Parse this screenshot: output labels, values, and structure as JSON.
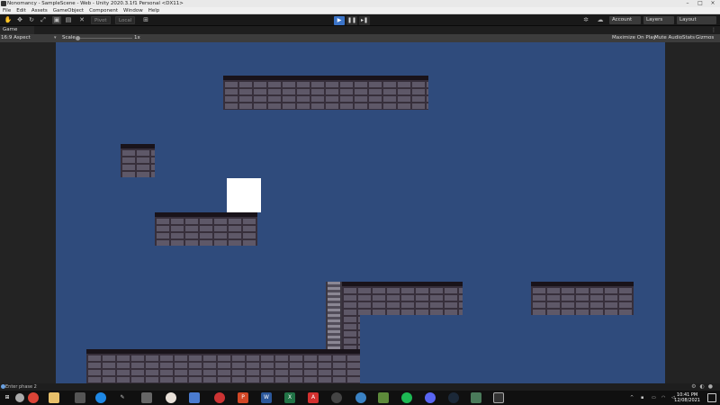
{
  "window": {
    "title": "Nonomancy - SampleScene - Web - Unity 2020.3.1f1 Personal <DX11>"
  },
  "menu": [
    "File",
    "Edit",
    "Assets",
    "GameObject",
    "Component",
    "Window",
    "Help"
  ],
  "toolbar": {
    "pivot_label": "Pivot",
    "local_label": "Local",
    "account_label": "Account",
    "layers_label": "Layers",
    "layout_label": "Layout"
  },
  "game_tab": {
    "label": "Game"
  },
  "game_controls": {
    "aspect": "16:9 Aspect",
    "scale_label": "Scale",
    "scale_value": "1x",
    "maximize": "Maximize On Play",
    "mute": "Mute Audio",
    "stats": "Stats",
    "gizmos": "Gizmos"
  },
  "status": {
    "message": "Enter phase 2"
  },
  "clock": {
    "time": "10:41 PM",
    "date": "12/08/2021"
  },
  "colors": {
    "game_background": "#2f4b7c",
    "play_active": "#3b74c8",
    "player": "#ffffff"
  }
}
